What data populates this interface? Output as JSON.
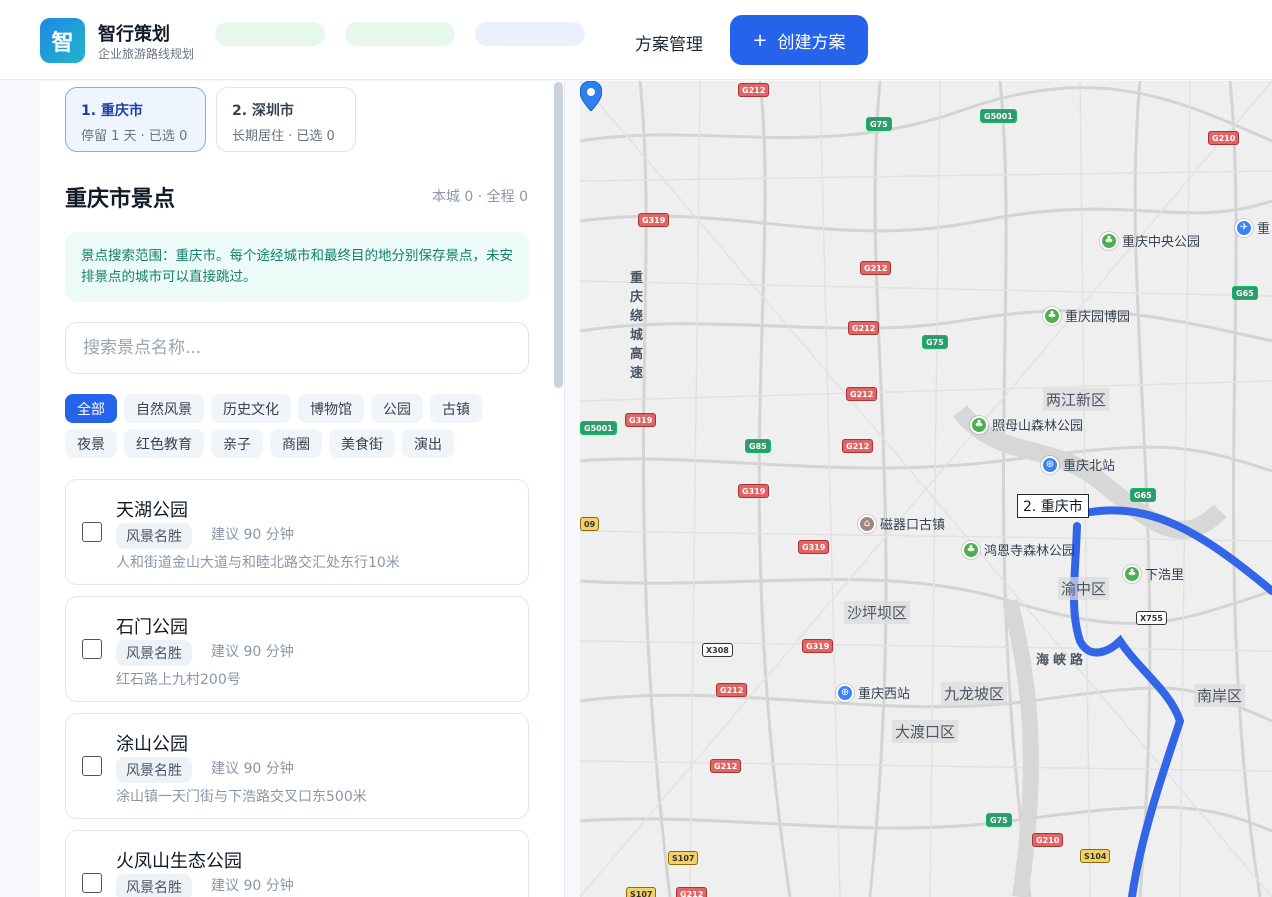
{
  "header": {
    "logo_char": "智",
    "app_name": "智行策划",
    "app_subtitle": "企业旅游路线规划",
    "nav_link": "方案管理",
    "create_button": "创建方案",
    "create_icon": "plus-icon"
  },
  "city_tabs": [
    {
      "name": "1. 重庆市",
      "meta": "停留 1 天 · 已选 0",
      "active": true
    },
    {
      "name": "2. 深圳市",
      "meta": "长期居住 · 已选 0",
      "active": false
    }
  ],
  "section": {
    "title": "重庆市景点",
    "count": "本城 0 · 全程 0",
    "notice": "景点搜索范围：重庆市。每个途经城市和最终目的地分别保存景点，未安排景点的城市可以直接跳过。"
  },
  "search": {
    "placeholder": "搜索景点名称..."
  },
  "categories": [
    "全部",
    "自然风景",
    "历史文化",
    "博物馆",
    "公园",
    "古镇",
    "夜景",
    "红色教育",
    "亲子",
    "商圈",
    "美食街",
    "演出"
  ],
  "active_category": "全部",
  "attractions": [
    {
      "name": "天湖公园",
      "tag": "风景名胜",
      "duration": "建议 90 分钟",
      "address": "人和街道金山大道与和睦北路交汇处东行10米"
    },
    {
      "name": "石门公园",
      "tag": "风景名胜",
      "duration": "建议 90 分钟",
      "address": "红石路上九村200号"
    },
    {
      "name": "涂山公园",
      "tag": "风景名胜",
      "duration": "建议 90 分钟",
      "address": "涂山镇一天门街与下浩路交叉口东500米"
    },
    {
      "name": "火凤山生态公园",
      "tag": "风景名胜",
      "duration": "建议 90 分钟",
      "address": ""
    }
  ],
  "map": {
    "marker_label": "2. 重庆市",
    "route_color": "#3366e6",
    "districts": [
      "两江新区",
      "渝中区",
      "沙坪坝区",
      "九龙坡区",
      "大渡口区",
      "南岸区"
    ],
    "pois": [
      {
        "name": "重庆中央公园",
        "icon": "park-icon"
      },
      {
        "name": "重庆园博园",
        "icon": "park-icon"
      },
      {
        "name": "照母山森林公园",
        "icon": "park-icon"
      },
      {
        "name": "重庆北站",
        "icon": "train-station-icon"
      },
      {
        "name": "磁器口古镇",
        "icon": "landmark-icon"
      },
      {
        "name": "鸿恩寺森林公园",
        "icon": "park-icon"
      },
      {
        "name": "下浩里",
        "icon": "park-icon"
      },
      {
        "name": "重庆西站",
        "icon": "train-station-icon"
      },
      {
        "name": "重",
        "icon": "airport-icon"
      }
    ],
    "road_labels": [
      "重庆绕城高速",
      "海峡路"
    ],
    "shields": [
      "G212",
      "G75",
      "G5001",
      "G210",
      "G319",
      "G212",
      "G212",
      "G75",
      "G212",
      "G319",
      "G5001",
      "G85",
      "G212",
      "G319",
      "G65",
      "G319",
      "X308",
      "G319",
      "X755",
      "G212",
      "G212",
      "G75",
      "G210",
      "S107",
      "S104",
      "S107",
      "G212",
      "G65",
      "09"
    ]
  }
}
